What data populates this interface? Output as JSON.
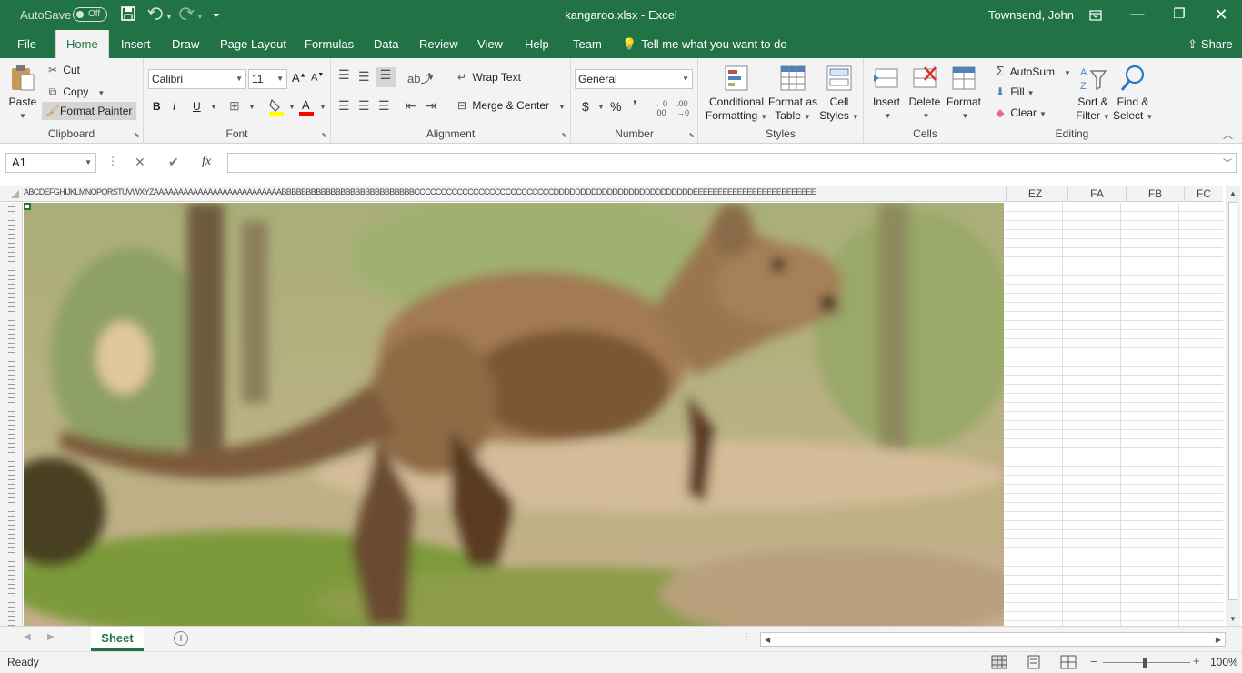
{
  "title_bar": {
    "autosave_label": "AutoSave",
    "autosave_state": "Off",
    "document_title": "kangaroo.xlsx  -  Excel",
    "user_name": "Townsend, John",
    "icons": [
      "save-icon",
      "undo-icon",
      "redo-icon",
      "customize-icon",
      "ribbon-display-icon",
      "minimize-icon",
      "restore-icon",
      "close-icon"
    ]
  },
  "tabs": [
    {
      "label": "File",
      "active": false
    },
    {
      "label": "Home",
      "active": true
    },
    {
      "label": "Insert",
      "active": false
    },
    {
      "label": "Draw",
      "active": false
    },
    {
      "label": "Page Layout",
      "active": false
    },
    {
      "label": "Formulas",
      "active": false
    },
    {
      "label": "Data",
      "active": false
    },
    {
      "label": "Review",
      "active": false
    },
    {
      "label": "View",
      "active": false
    },
    {
      "label": "Help",
      "active": false
    },
    {
      "label": "Team",
      "active": false
    }
  ],
  "tell_me": "Tell me what you want to do",
  "share": "Share",
  "ribbon": {
    "clipboard": {
      "label": "Clipboard",
      "paste": "Paste",
      "cut": "Cut",
      "copy": "Copy",
      "format_painter": "Format Painter"
    },
    "font": {
      "label": "Font",
      "font_name": "Calibri",
      "font_size": "11",
      "bold": "B",
      "italic": "I",
      "underline": "U",
      "font_color": "#ff0000",
      "highlight_color": "#ffff00"
    },
    "alignment": {
      "label": "Alignment",
      "wrap_text": "Wrap Text",
      "merge_center": "Merge & Center"
    },
    "number": {
      "label": "Number",
      "format": "General",
      "currency": "$",
      "percent": "%",
      "comma": "’"
    },
    "styles": {
      "label": "Styles",
      "conditional": [
        "Conditional",
        "Formatting"
      ],
      "format_table": [
        "Format as",
        "Table"
      ],
      "cell_styles": [
        "Cell",
        "Styles"
      ]
    },
    "cells": {
      "label": "Cells",
      "insert": "Insert",
      "delete": "Delete",
      "format": "Format"
    },
    "editing": {
      "label": "Editing",
      "autosum": "AutoSum",
      "fill": "Fill",
      "clear": "Clear",
      "sort_filter": [
        "Sort &",
        "Filter"
      ],
      "find_select": [
        "Find &",
        "Select"
      ]
    }
  },
  "formula_bar": {
    "name_box": "A1",
    "cancel": "✕",
    "enter": "✔",
    "fx": "fx",
    "content": ""
  },
  "grid": {
    "micro_column_headers": "ABCDEFGHIJKLMNOPQRSTUVWXYZAAAAAAAAAAAAAAAAAAAAAAAAAABBBBBBBBBBBBBBBBBBBBBBBBBBBCCCCCCCCCCCCCCCCCCCCCCCCCCDDDDDDDDDDDDDDDDDDDDDDDDDDEEEEEEEEEEEEEEEEEEEEEEEEE",
    "visible_columns": [
      "EZ",
      "FA",
      "FB",
      "FC"
    ],
    "picture_colors": {
      "bg_green": "#a5ac6e",
      "bark": "#6e5a3c",
      "fur": "#a27a52",
      "fur_dark": "#5a3a22",
      "ground": "#c9ad8a",
      "grass": "#7d9a3a",
      "sky_light": "#d8cfa2"
    }
  },
  "sheet_tabs": [
    "Sheet"
  ],
  "status_bar": {
    "status": "Ready",
    "zoom": "100%"
  }
}
